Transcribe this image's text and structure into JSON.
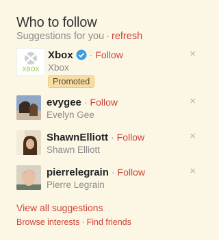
{
  "header": {
    "title": "Who to follow",
    "subtitle": "Suggestions for you",
    "separator": "·",
    "refresh_label": "refresh"
  },
  "suggestions": [
    {
      "handle": "Xbox",
      "name": "Xbox",
      "follow_label": "Follow",
      "verified": true,
      "promoted_label": "Promoted",
      "logo_text": "XBOX",
      "close": "×"
    },
    {
      "handle": "evygee",
      "name": "Evelyn Gee",
      "follow_label": "Follow",
      "close": "×"
    },
    {
      "handle": "ShawnElliott",
      "name": "Shawn Elliott",
      "follow_label": "Follow",
      "close": "×"
    },
    {
      "handle": "pierrelegrain",
      "name": "Pierre Legrain",
      "follow_label": "Follow",
      "close": "×"
    }
  ],
  "footer": {
    "view_all": "View all suggestions",
    "browse_interests": "Browse interests",
    "separator": "·",
    "find_friends": "Find friends"
  },
  "colors": {
    "background": "#fbf7e4",
    "link": "#d0423a",
    "muted": "#8a8a8a",
    "promoted_bg": "#f7dda4",
    "verified": "#3d9ee0"
  }
}
